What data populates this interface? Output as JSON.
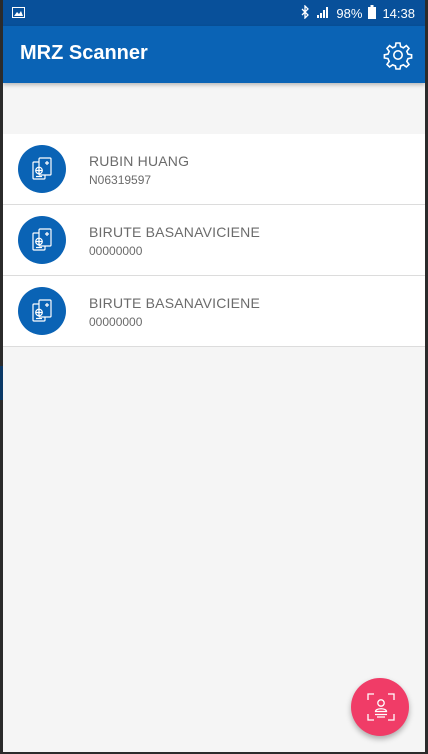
{
  "status_bar": {
    "battery": "98%",
    "time": "14:38",
    "icons": [
      "image-icon",
      "bluetooth-icon",
      "signal-icon",
      "battery-icon"
    ]
  },
  "app_bar": {
    "title": "MRZ Scanner",
    "settings_icon": "gear-icon"
  },
  "list": {
    "items": [
      {
        "name": "RUBIN HUANG",
        "document_number": "N06319597",
        "icon": "passport-icon"
      },
      {
        "name": "BIRUTE BASANAVICIENE",
        "document_number": "00000000",
        "icon": "passport-icon"
      },
      {
        "name": "BIRUTE BASANAVICIENE",
        "document_number": "00000000",
        "icon": "passport-icon"
      }
    ]
  },
  "fab": {
    "icon": "scan-id-icon"
  },
  "colors": {
    "status_bar": "#08509a",
    "app_bar": "#0a63b5",
    "avatar": "#0a63b5",
    "fab": "#f03c67",
    "background": "#f5f5f5"
  }
}
